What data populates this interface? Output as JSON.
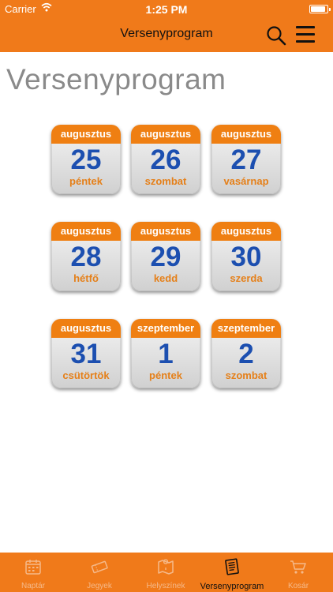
{
  "status_bar": {
    "carrier": "Carrier",
    "time": "1:25 PM"
  },
  "nav": {
    "title": "Versenyprogram"
  },
  "page": {
    "title": "Versenyprogram"
  },
  "days": [
    {
      "month": "augusztus",
      "day": "25",
      "weekday": "péntek"
    },
    {
      "month": "augusztus",
      "day": "26",
      "weekday": "szombat"
    },
    {
      "month": "augusztus",
      "day": "27",
      "weekday": "vasárnap"
    },
    {
      "month": "augusztus",
      "day": "28",
      "weekday": "hétfő"
    },
    {
      "month": "augusztus",
      "day": "29",
      "weekday": "kedd"
    },
    {
      "month": "augusztus",
      "day": "30",
      "weekday": "szerda"
    },
    {
      "month": "augusztus",
      "day": "31",
      "weekday": "csütörtök"
    },
    {
      "month": "szeptember",
      "day": "1",
      "weekday": "péntek"
    },
    {
      "month": "szeptember",
      "day": "2",
      "weekday": "szombat"
    }
  ],
  "tabs": [
    {
      "label": "Naptár",
      "icon": "calendar-icon",
      "active": false
    },
    {
      "label": "Jegyek",
      "icon": "ticket-icon",
      "active": false
    },
    {
      "label": "Helyszínek",
      "icon": "map-icon",
      "active": false
    },
    {
      "label": "Versenyprogram",
      "icon": "program-icon",
      "active": true
    },
    {
      "label": "Kosár",
      "icon": "cart-icon",
      "active": false
    }
  ],
  "colors": {
    "header": "#f07a1a",
    "month_band": "#ef7f12",
    "day_number": "#1c4fb0",
    "weekday": "#e5801a"
  }
}
